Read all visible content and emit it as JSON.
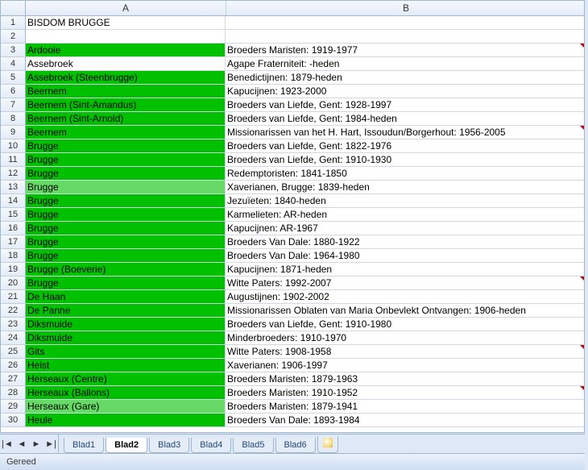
{
  "columns": {
    "A": "A",
    "B": "B"
  },
  "title_row": {
    "a": "BISDOM BRUGGE",
    "b": ""
  },
  "rows": [
    {
      "a": "Ardooie",
      "b": "Broeders Maristen: 1919-1977",
      "fill": "green1",
      "comment": true
    },
    {
      "a": "Assebroek",
      "b": "Agape Fraterniteit: -heden",
      "fill": ""
    },
    {
      "a": "Assebroek (Steenbrugge)",
      "b": "Benedictijnen: 1879-heden",
      "fill": "green1"
    },
    {
      "a": "Beernem",
      "b": "Kapucijnen: 1923-2000",
      "fill": "green1"
    },
    {
      "a": "Beernem (Sint-Amandus)",
      "b": "Broeders van Liefde, Gent: 1928-1997",
      "fill": "green1"
    },
    {
      "a": "Beernem (Sint-Arnold)",
      "b": "Broeders van Liefde, Gent: 1984-heden",
      "fill": "green1"
    },
    {
      "a": "Beernem",
      "b": "Missionarissen van het H. Hart, Issoudun/Borgerhout: 1956-2005",
      "fill": "green1",
      "comment": true
    },
    {
      "a": "Brugge",
      "b": "Broeders van Liefde, Gent: 1822-1976",
      "fill": "green1"
    },
    {
      "a": "Brugge",
      "b": "Broeders van Liefde, Gent: 1910-1930",
      "fill": "green1"
    },
    {
      "a": "Brugge",
      "b": "Redemptoristen: 1841-1850",
      "fill": "green1"
    },
    {
      "a": "Brugge",
      "b": "Xaverianen, Brugge: 1839-heden",
      "fill": "green2"
    },
    {
      "a": "Brugge",
      "b": "Jezuïeten: 1840-heden",
      "fill": "green1"
    },
    {
      "a": "Brugge",
      "b": "Karmelieten: AR-heden",
      "fill": "green1"
    },
    {
      "a": "Brugge",
      "b": "Kapucijnen: AR-1967",
      "fill": "green1"
    },
    {
      "a": "Brugge",
      "b": "Broeders Van Dale: 1880-1922",
      "fill": "green1"
    },
    {
      "a": "Brugge",
      "b": "Broeders Van Dale: 1964-1980",
      "fill": "green1"
    },
    {
      "a": "Brugge (Boeverie)",
      "b": "Kapucijnen: 1871-heden",
      "fill": "green1"
    },
    {
      "a": "Brugge",
      "b": "Witte Paters: 1992-2007",
      "fill": "green1",
      "comment": true
    },
    {
      "a": "De Haan",
      "b": "Augustijnen: 1902-2002",
      "fill": "green1"
    },
    {
      "a": "De Panne",
      "b": "Missionarissen Oblaten van Maria Onbevlekt Ontvangen: 1906-heden",
      "fill": "green1"
    },
    {
      "a": "Diksmuide",
      "b": "Broeders van Liefde, Gent: 1910-1980",
      "fill": "green1"
    },
    {
      "a": "Diksmuide",
      "b": "Minderbroeders: 1910-1970",
      "fill": "green1"
    },
    {
      "a": "Gits",
      "b": "Witte Paters: 1908-1958",
      "fill": "green1",
      "comment": true
    },
    {
      "a": "Heist",
      "b": "Xaverianen: 1906-1997",
      "fill": "green1"
    },
    {
      "a": "Herseaux (Centre)",
      "b": "Broeders Maristen: 1879-1963",
      "fill": "green1"
    },
    {
      "a": "Herseaux (Ballons)",
      "b": "Broeders Maristen: 1910-1952",
      "fill": "green1",
      "comment": true
    },
    {
      "a": "Herseaux (Gare)",
      "b": "Broeders Maristen: 1879-1941",
      "fill": "green2"
    },
    {
      "a": "Heule",
      "b": "Broeders Van Dale: 1893-1984",
      "fill": "green1"
    }
  ],
  "tabs": {
    "items": [
      {
        "label": "Blad1"
      },
      {
        "label": "Blad2"
      },
      {
        "label": "Blad3"
      },
      {
        "label": "Blad4"
      },
      {
        "label": "Blad5"
      },
      {
        "label": "Blad6"
      }
    ],
    "active_index": 1
  },
  "nav": {
    "first": "|◄",
    "prev": "◄",
    "next": "►",
    "last": "►|"
  },
  "status": {
    "ready": "Gereed"
  }
}
